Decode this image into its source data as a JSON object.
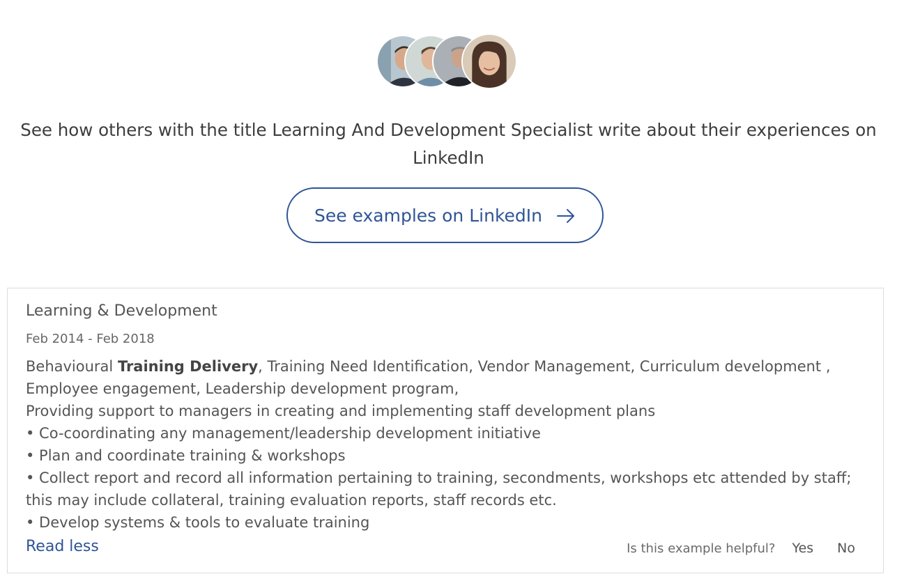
{
  "avatars": [
    {
      "name": "avatar-1",
      "bg": "#b8c6cf"
    },
    {
      "name": "avatar-2",
      "bg": "#cfd8d4"
    },
    {
      "name": "avatar-3",
      "bg": "#aab0b6"
    },
    {
      "name": "avatar-4",
      "bg": "#d9cbb8"
    }
  ],
  "headline": "See how others with the title Learning And Development Specialist write about their experiences on LinkedIn",
  "cta": {
    "label": "See examples on LinkedIn",
    "icon": "arrow-right-icon",
    "color": "#2f5596"
  },
  "example": {
    "role": "Learning & Development",
    "dates": "Feb 2014 - Feb 2018",
    "line1_prefix": "Behavioural ",
    "line1_bold": "Training Delivery",
    "line1_suffix": ", Training Need Identification, Vendor Management, Curriculum development ,",
    "line2": "Employee engagement, Leadership development program,",
    "line3": "Providing support to managers in creating and implementing staff development plans",
    "bullets": [
      "• Co-coordinating any management/leadership development initiative",
      "• Plan and coordinate training & workshops",
      "• Collect report and record all information pertaining to training, secondments, workshops etc attended by staff; this may include collateral, training evaluation reports, staff records etc.",
      "• Develop systems & tools to evaluate training"
    ],
    "read_less": "Read less"
  },
  "feedback": {
    "question": "Is this example helpful?",
    "yes": "Yes",
    "no": "No"
  }
}
